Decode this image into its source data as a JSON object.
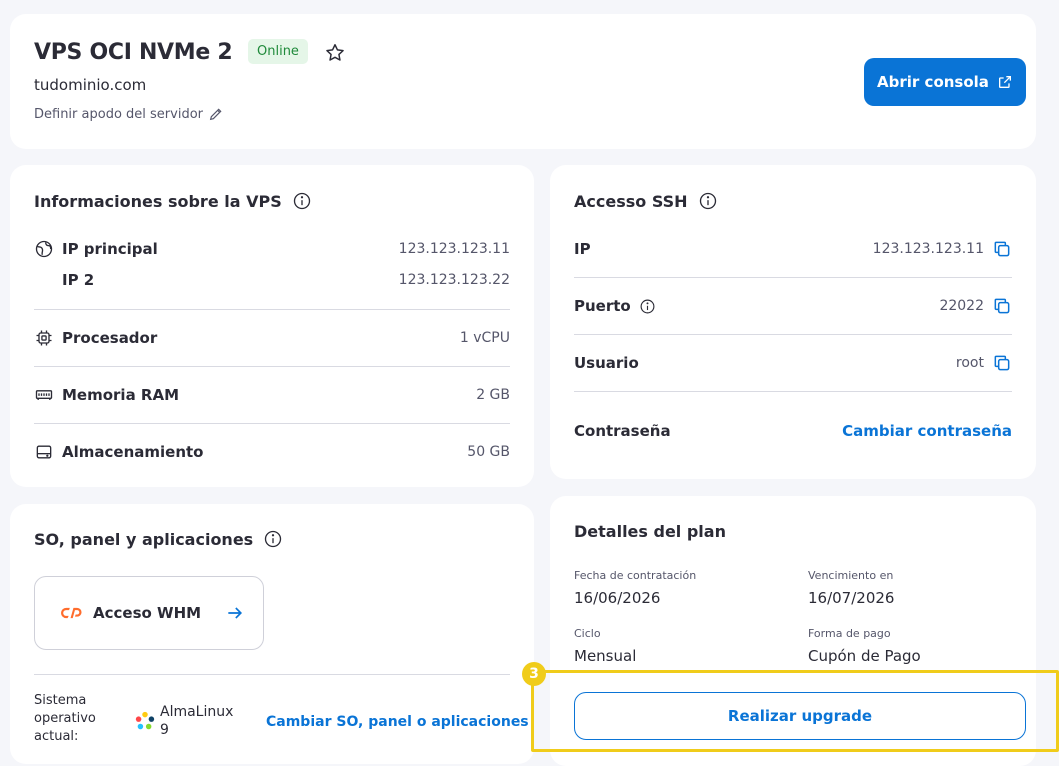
{
  "header": {
    "title": "VPS OCI NVMe 2",
    "status": "Online",
    "domain": "tudominio.com",
    "nickname_label": "Definir apodo del servidor",
    "console_button": "Abrir consola"
  },
  "vps_info": {
    "title": "Informaciones sobre la VPS",
    "ip_main_label": "IP principal",
    "ip_main_value": "123.123.123.11",
    "ip2_label": "IP 2",
    "ip2_value": "123.123.123.22",
    "cpu_label": "Procesador",
    "cpu_value": "1 vCPU",
    "ram_label": "Memoria RAM",
    "ram_value": "2 GB",
    "storage_label": "Almacenamiento",
    "storage_value": "50 GB"
  },
  "ssh": {
    "title": "Accesso SSH",
    "ip_label": "IP",
    "ip_value": "123.123.123.11",
    "port_label": "Puerto",
    "port_value": "22022",
    "user_label": "Usuario",
    "user_value": "root",
    "password_label": "Contraseña",
    "password_link": "Cambiar contraseña"
  },
  "so": {
    "title": "SO, panel y aplicaciones",
    "whm_label": "Acceso WHM",
    "os_label": "Sistema operativo actual:",
    "os_value": "AlmaLinux 9",
    "change_link": "Cambiar SO, panel o aplicaciones"
  },
  "plan": {
    "title": "Detalles del plan",
    "contract_label": "Fecha de contratación",
    "contract_value": "16/06/2026",
    "expiry_label": "Vencimiento en",
    "expiry_value": "16/07/2026",
    "cycle_label": "Ciclo",
    "cycle_value": "Mensual",
    "payment_label": "Forma de pago",
    "payment_value": "Cupón de Pago",
    "upgrade_button": "Realizar upgrade"
  },
  "tutorial": {
    "step": "3",
    "highlight_color": "#f0cc1a"
  },
  "colors": {
    "accent": "#0a74d6",
    "online_bg": "#e5f6e8",
    "online_text": "#1f8a3a"
  }
}
